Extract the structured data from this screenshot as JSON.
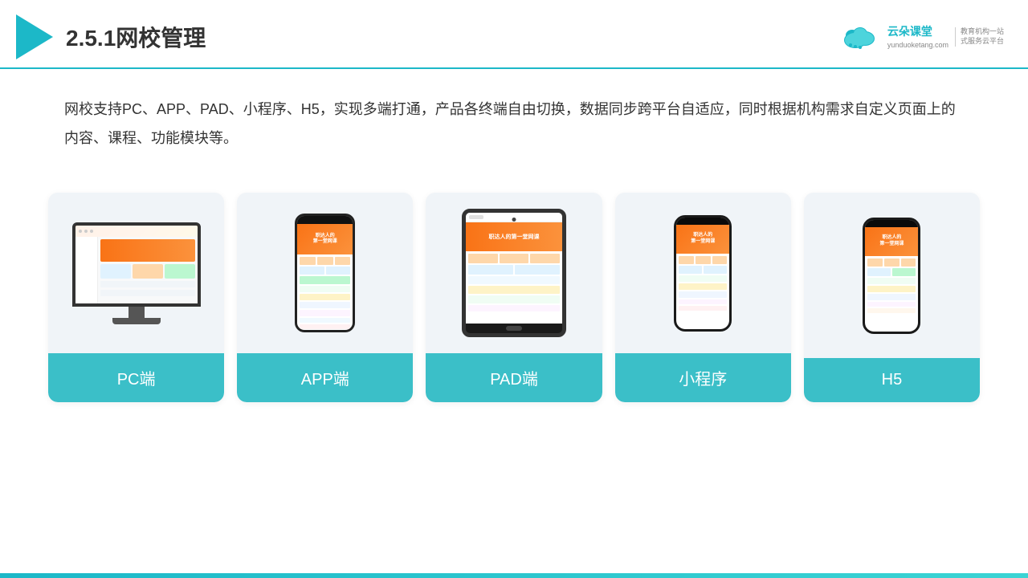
{
  "header": {
    "title": "2.5.1网校管理",
    "brand": {
      "name": "云朵课堂",
      "url": "yunduoketang.com",
      "slogan_line1": "教育机构一站",
      "slogan_line2": "式服务云平台"
    }
  },
  "description": {
    "text": "网校支持PC、APP、PAD、小程序、H5，实现多端打通，产品各终端自由切换，数据同步跨平台自适应，同时根据机构需求自定义页面上的内容、课程、功能模块等。"
  },
  "cards": [
    {
      "id": "pc",
      "label": "PC端"
    },
    {
      "id": "app",
      "label": "APP端"
    },
    {
      "id": "pad",
      "label": "PAD端"
    },
    {
      "id": "mini",
      "label": "小程序"
    },
    {
      "id": "h5",
      "label": "H5"
    }
  ],
  "colors": {
    "accent": "#1cb8c8",
    "card_label_bg": "#3bbfc8",
    "triangle": "#1cb8c8"
  }
}
